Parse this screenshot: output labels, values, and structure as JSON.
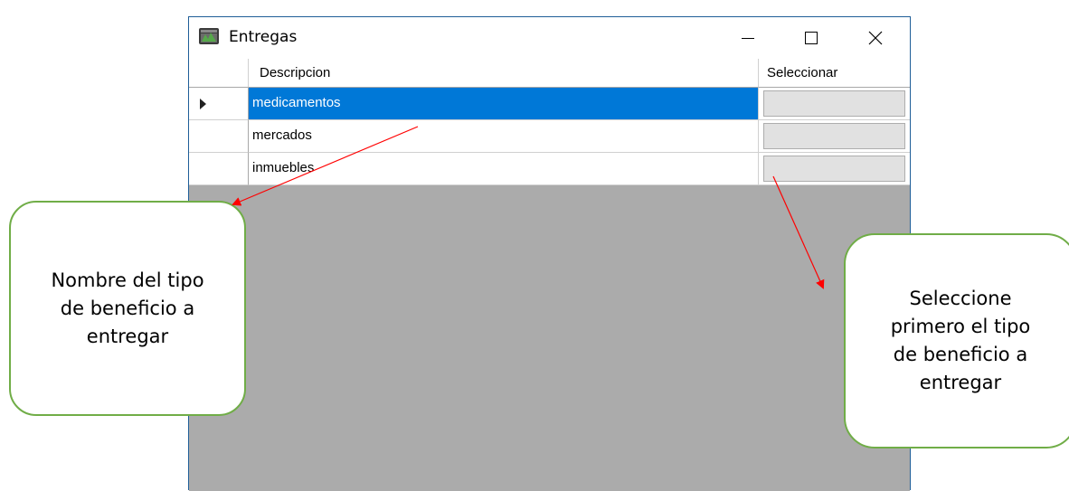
{
  "window": {
    "title": "Entregas",
    "icon": "app-icon",
    "controls": [
      "minimize-icon",
      "maximize-icon",
      "close-icon"
    ]
  },
  "grid": {
    "columns": [
      "Descripcion",
      "Seleccionar"
    ],
    "rows": [
      {
        "descripcion": "medicamentos",
        "selected": true
      },
      {
        "descripcion": "mercados",
        "selected": false
      },
      {
        "descripcion": "inmuebles",
        "selected": false
      }
    ]
  },
  "callouts": {
    "left": {
      "line1": "Nombre del tipo",
      "line2": "de beneficio a",
      "line3": "entregar"
    },
    "right": {
      "line1": "Seleccione",
      "line2": "primero el tipo",
      "line3": "de beneficio a",
      "line4": "entregar"
    }
  },
  "colors": {
    "selection": "#0078d7",
    "callout_border": "#70ad47",
    "arrow": "#ff0000",
    "grid_background": "#ababab"
  }
}
